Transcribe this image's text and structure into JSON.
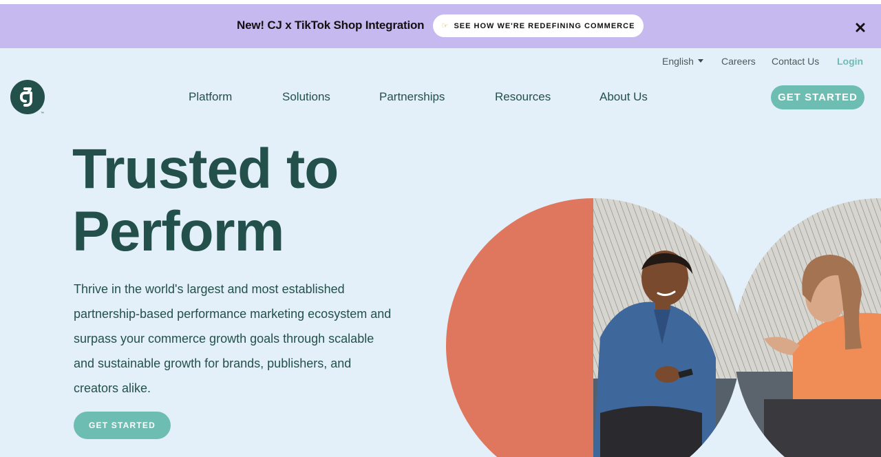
{
  "banner": {
    "headline": "New! CJ x TikTok Shop Integration",
    "cta_icon": "pointing-hand-icon",
    "cta_label": "SEE HOW WE'RE REDEFINING COMMERCE",
    "close_icon": "close-icon",
    "background": "#c6b9ef"
  },
  "utility_nav": {
    "language": "English",
    "careers": "Careers",
    "contact": "Contact Us",
    "login": "Login"
  },
  "logo": {
    "text": "CJ",
    "trademark": "™"
  },
  "main_nav": {
    "items": [
      "Platform",
      "Solutions",
      "Partnerships",
      "Resources",
      "About Us"
    ]
  },
  "header_cta": "GET STARTED",
  "hero": {
    "title_line1": "Trusted to",
    "title_line2": "Perform",
    "subtitle": "Thrive in the world's largest and most established partnership-based performance marketing ecosystem and surpass your commerce growth goals through scalable and sustainable growth for brands, publishers, and creators alike.",
    "cta": "GET STARTED"
  },
  "colors": {
    "page_bg": "#e3f0f9",
    "brand_dark": "#23504a",
    "accent_teal": "#6dbdb2",
    "accent_coral": "#df775e"
  }
}
